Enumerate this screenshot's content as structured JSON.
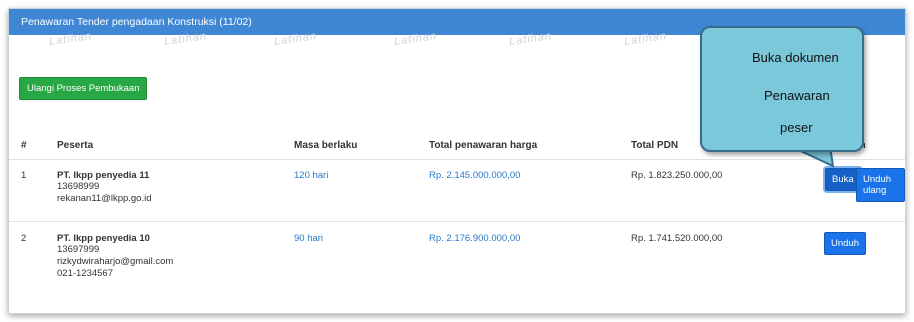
{
  "panel": {
    "title": "Penawaran Tender pengadaan Konstruksi (11/02)"
  },
  "watermark": "Latihan",
  "actions": {
    "reprocess_label": "Ulangi Proses Pembukaan"
  },
  "table": {
    "headers": [
      "#",
      "Peserta",
      "Masa berlaku",
      "Total penawaran harga",
      "Total PDN",
      "en"
    ],
    "rows": [
      {
        "num": "1",
        "name": "PT. lkpp penyedia 11",
        "line1": "13698999",
        "line2": "rekanan11@lkpp.go.id",
        "line3": "",
        "validity": "120 hari",
        "price": "Rp. 2.145.000.000,00",
        "pdn": "Rp. 1.823.250.000,00",
        "btn1": "Buka",
        "btn2": "Unduh ulang"
      },
      {
        "num": "2",
        "name": "PT. lkpp penyedia 10",
        "line1": "13697999",
        "line2": "rizkydwiraharjo@gmail.com",
        "line3": "021-1234567",
        "validity": "90 hari",
        "price": "Rp. 2.176.900.000,00",
        "pdn": "Rp. 1.741.520.000,00",
        "btn1": "Unduh"
      }
    ]
  },
  "callout": {
    "line1": "Buka dokumen",
    "line2": "Penawaran",
    "line3": "peser"
  },
  "colors": {
    "header": "#3f87d4",
    "green": "#28a745",
    "blue": "#1a73e8",
    "callout": "#7bc8db"
  }
}
